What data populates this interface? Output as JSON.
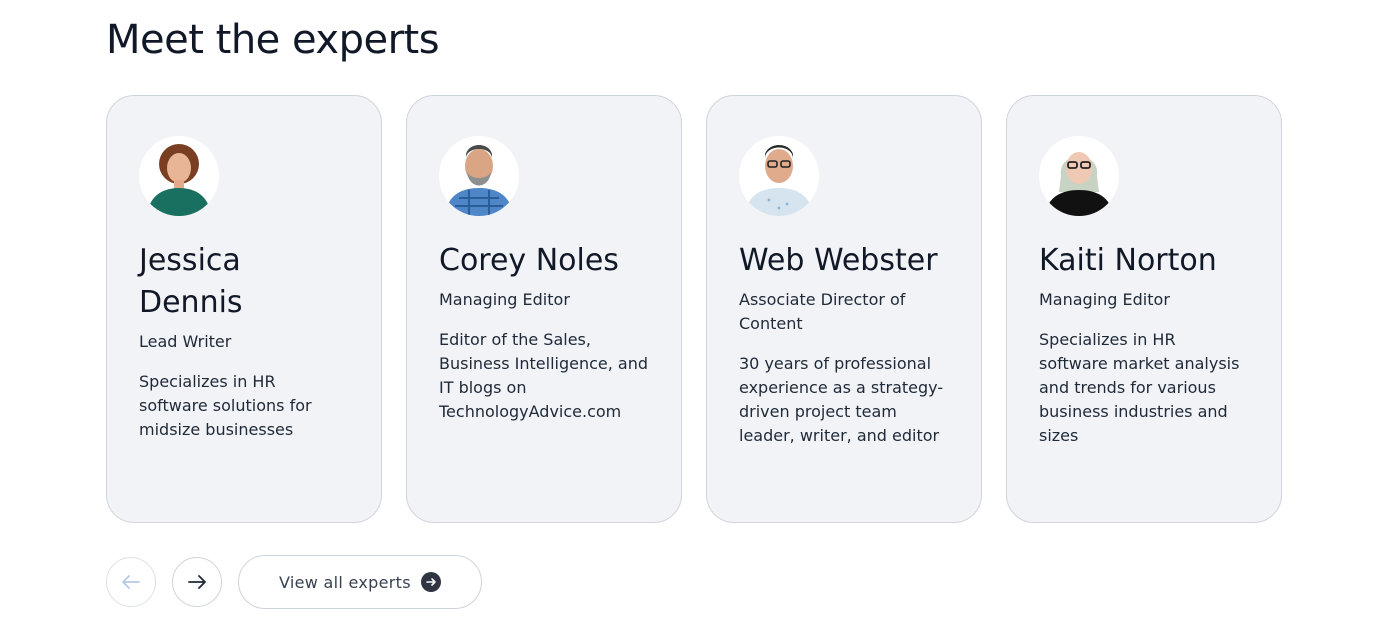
{
  "section": {
    "title": "Meet the experts"
  },
  "experts": [
    {
      "name": "Jessica Dennis",
      "role": "Lead Writer",
      "description": "Specializes in HR software solutions for midsize businesses",
      "avatar_icon": "person-portrait-icon"
    },
    {
      "name": "Corey Noles",
      "role": "Managing Editor",
      "description": "Editor of the Sales, Business Intelligence, and IT blogs on TechnologyAdvice.com",
      "avatar_icon": "person-portrait-icon"
    },
    {
      "name": "Web Webster",
      "role": "Associate Director of Content",
      "description": "30 years of professional experience as a strategy-driven project team leader, writer, and editor",
      "avatar_icon": "person-portrait-icon"
    },
    {
      "name": "Kaiti Norton",
      "role": "Managing Editor",
      "description": "Specializes in HR software market analysis and trends for various business industries and sizes",
      "avatar_icon": "person-portrait-icon"
    }
  ],
  "controls": {
    "prev_icon": "arrow-left-icon",
    "next_icon": "arrow-right-icon",
    "view_all_label": "View all experts",
    "view_all_icon": "arrow-right-circle-icon"
  },
  "colors": {
    "card_background": "#f1f3f7",
    "card_border": "#cfd4dc",
    "heading_text": "#111827",
    "button_icon_dark": "#2f3542",
    "disabled_arrow": "#b6c9e6"
  }
}
